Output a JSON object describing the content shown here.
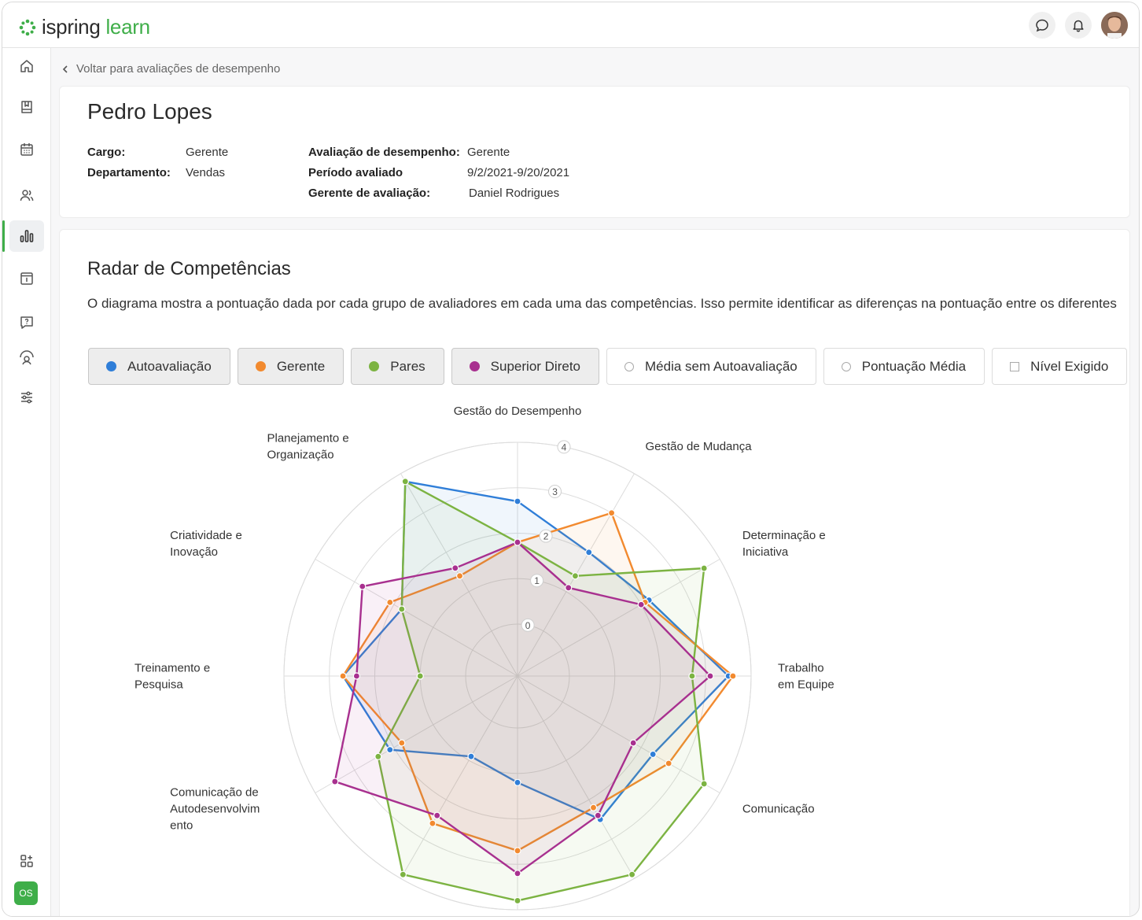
{
  "app": {
    "logo_part1": "ispring",
    "logo_part2": "learn",
    "user_initials": "OS"
  },
  "nav": {
    "back_label": "Voltar para avaliações de desempenho"
  },
  "person": {
    "name": "Pedro Lopes",
    "cargo_label": "Cargo:",
    "cargo": "Gerente",
    "depto_label": "Departamento:",
    "depto": "Vendas",
    "aval_label": "Avaliação de desempenho:",
    "aval": "Gerente",
    "periodo_label": "Período avaliado",
    "periodo": "9/2/2021-9/20/2021",
    "gerente_label": "Gerente de avaliação:",
    "gerente": "Daniel Rodrigues"
  },
  "section": {
    "title": "Radar de Competências",
    "description": "O diagrama mostra a pontuação dada por cada grupo de avaliadores em cada uma das competências. Isso permite identificar as diferenças na pontuação entre os diferentes"
  },
  "legend": [
    {
      "label": "Autoavaliação",
      "color": "#2f7ed8",
      "active": true
    },
    {
      "label": "Gerente",
      "color": "#f28a2f",
      "active": true
    },
    {
      "label": "Pares",
      "color": "#7cb342",
      "active": true
    },
    {
      "label": "Superior Direto",
      "color": "#a8308f",
      "active": true
    },
    {
      "label": "Média sem Autoavaliação",
      "active": false,
      "marker": "ring"
    },
    {
      "label": "Pontuação Média",
      "active": false,
      "marker": "ring"
    },
    {
      "label": "Nível Exigido",
      "active": false,
      "marker": "square"
    }
  ],
  "chart_data": {
    "type": "radar",
    "axes": [
      "Gestão do Desempenho",
      "Gestão de Mudança",
      "Determinação e Iniciativa",
      "Trabalho em Equipe",
      "Comunicação",
      "",
      "",
      "",
      "Comunicação de Autodesenvolvimento",
      "Treinamento e Pesquisa",
      "Criatividade e Inovação",
      "Planejamento e Organização"
    ],
    "axis_labels": [
      [
        "Gestão do Desempenho"
      ],
      [
        "Gestão de Mudança"
      ],
      [
        "Determinação e",
        "Iniciativa"
      ],
      [
        "Trabalho",
        "em Equipe"
      ],
      [
        "Comunicação"
      ],
      [],
      [],
      [],
      [
        "Comunicação de",
        "Autodesenvolvim",
        "ento"
      ],
      [
        "Treinamento e",
        "Pesquisa"
      ],
      [
        "Criatividade e",
        "Inovação"
      ],
      [
        "Planejamento e",
        "Organização"
      ]
    ],
    "rmin": 0,
    "rmax": 4,
    "ticks": [
      0,
      1,
      2,
      3,
      4
    ],
    "series": [
      {
        "name": "Autoavaliação",
        "color": "#2f7ed8",
        "values": [
          2.7,
          2.0,
          2.2,
          3.5,
          2.3,
          2.5,
          1.2,
          0.9,
          2.1,
          2.7,
          1.8,
          3.8
        ]
      },
      {
        "name": "Gerente",
        "color": "#f28a2f",
        "values": [
          1.8,
          3.0,
          2.1,
          3.6,
          2.7,
          2.2,
          2.7,
          2.6,
          1.8,
          2.7,
          2.1,
          1.4
        ]
      },
      {
        "name": "Pares",
        "color": "#7cb342",
        "values": [
          1.8,
          1.4,
          3.6,
          2.7,
          3.6,
          3.9,
          3.8,
          3.9,
          2.4,
          1.0,
          1.8,
          3.8
        ]
      },
      {
        "name": "Superior Direto",
        "color": "#a8308f",
        "values": [
          1.8,
          1.1,
          2.0,
          3.1,
          1.8,
          2.4,
          3.2,
          2.4,
          3.5,
          2.4,
          2.8,
          1.6
        ]
      }
    ]
  }
}
